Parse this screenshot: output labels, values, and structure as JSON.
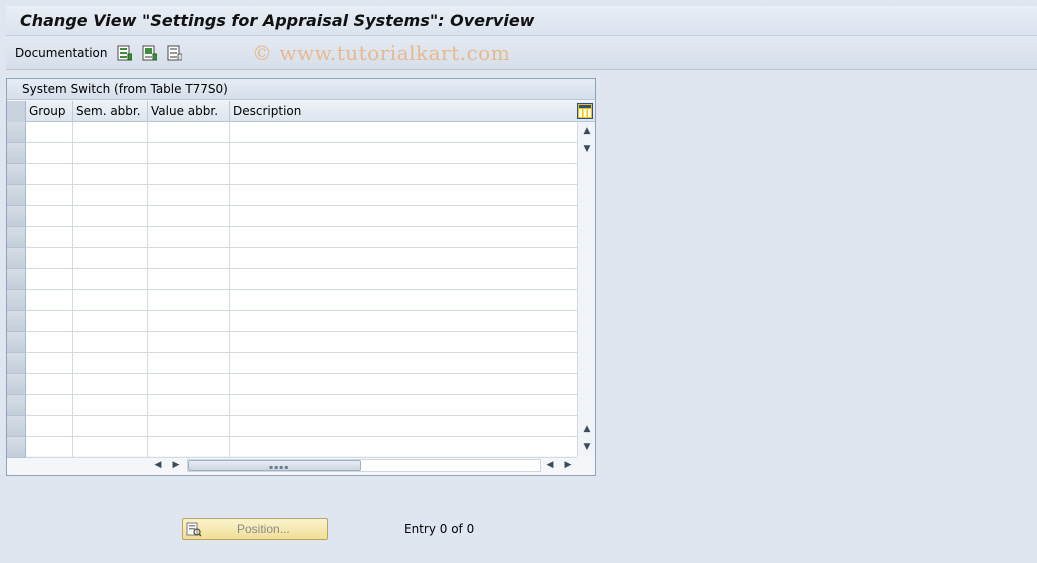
{
  "window": {
    "title": "Change View \"Settings for Appraisal Systems\": Overview"
  },
  "toolbar": {
    "documentation_label": "Documentation",
    "icons": [
      "select-all-icon",
      "select-block-icon",
      "deselect-all-icon"
    ],
    "watermark": "© www.tutorialkart.com"
  },
  "table": {
    "title": "System Switch (from Table T77S0)",
    "columns": [
      {
        "label": "Group"
      },
      {
        "label": "Sem. abbr."
      },
      {
        "label": "Value abbr."
      },
      {
        "label": "Description"
      }
    ],
    "visible_rows": 16,
    "rows": []
  },
  "footer": {
    "position_button_label": "Position...",
    "entry_text": "Entry 0 of 0"
  },
  "colors": {
    "background": "#dfe6ef",
    "button_yellow": "#f1df95",
    "watermark": "#e7b98f"
  }
}
